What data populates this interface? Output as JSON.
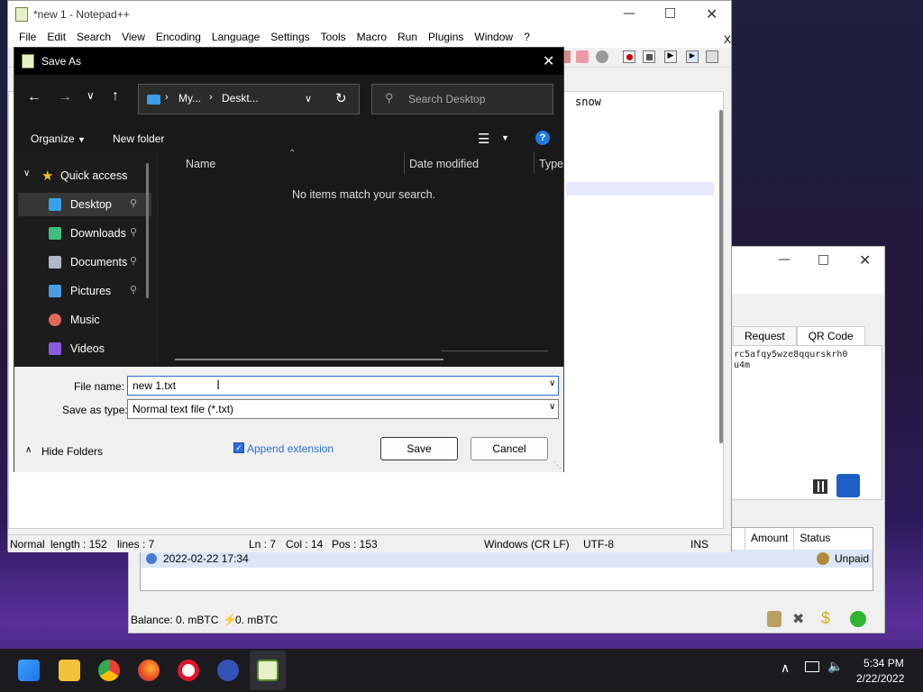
{
  "notepad": {
    "title": "*new 1 - Notepad++",
    "menu": [
      "File",
      "Edit",
      "Search",
      "View",
      "Encoding",
      "Language",
      "Settings",
      "Tools",
      "Macro",
      "Run",
      "Plugins",
      "Window",
      "?"
    ],
    "close_x": "X",
    "editor_visible_text": "snow",
    "status": {
      "mode": "Normal",
      "length": "length : 152",
      "lines": "lines : 7",
      "ln": "Ln : 7",
      "col": "Col : 14",
      "pos": "Pos : 153",
      "eol": "Windows (CR LF)",
      "encoding": "UTF-8",
      "ins": "INS"
    }
  },
  "wallet": {
    "tabs": [
      "Request",
      "QR Code"
    ],
    "address_fragment": [
      "rc5afqy5wze8qqurskrh0",
      "u4m"
    ],
    "history_headers": [
      "Amount",
      "Status"
    ],
    "history_row": {
      "date": "2022-02-22 17:34",
      "status": "Unpaid"
    },
    "balance": "Balance: 0. mBTC",
    "lightning_balance": "0. mBTC"
  },
  "dialog": {
    "title": "Save As",
    "breadcrumb": [
      "My...",
      "Deskt..."
    ],
    "search_placeholder": "Search Desktop",
    "organize": "Organize",
    "new_folder": "New folder",
    "help": "?",
    "quick_access": "Quick access",
    "sidebar": [
      {
        "label": "Desktop",
        "pinned": true,
        "color": "#3aa0e8"
      },
      {
        "label": "Downloads",
        "pinned": true,
        "color": "#3fbf7f"
      },
      {
        "label": "Documents",
        "pinned": true,
        "color": "#b0b8c8"
      },
      {
        "label": "Pictures",
        "pinned": true,
        "color": "#4a9de0"
      },
      {
        "label": "Music",
        "pinned": false,
        "color": "#e06a5a"
      },
      {
        "label": "Videos",
        "pinned": false,
        "color": "#8a5ae0"
      }
    ],
    "columns": [
      "Name",
      "Date modified",
      "Type"
    ],
    "empty_message": "No items match your search.",
    "file_name_label": "File name:",
    "file_name_value": "new 1.txt",
    "save_type_label": "Save as type:",
    "save_type_value": "Normal text file (*.txt)",
    "hide_folders": "Hide Folders",
    "append_extension": "Append extension",
    "save": "Save",
    "cancel": "Cancel"
  },
  "taskbar": {
    "time": "5:34 PM",
    "date": "2/22/2022"
  }
}
